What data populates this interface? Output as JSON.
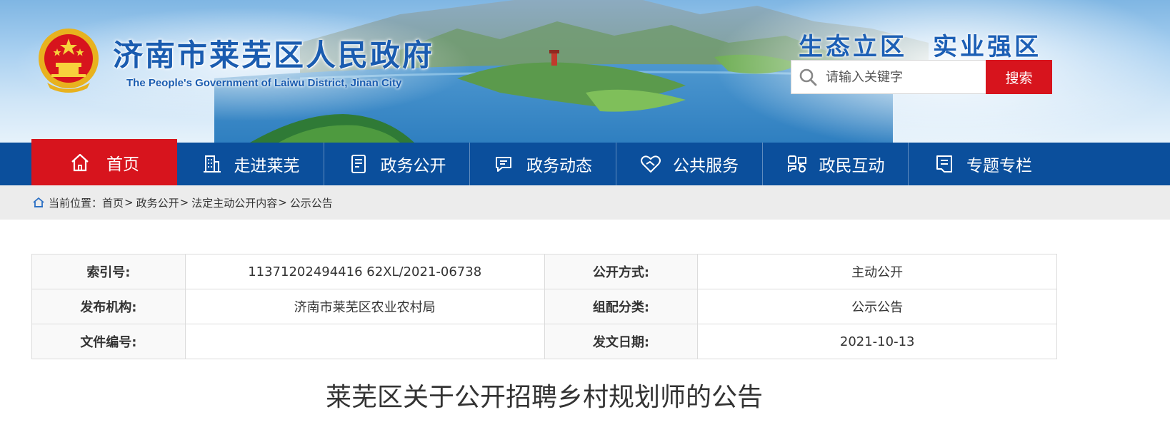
{
  "header": {
    "site_title": "济南市莱芜区人民政府",
    "site_subtitle": "The People's Government of Laiwu District, Jinan City",
    "slogan_left": "生态立区",
    "slogan_right": "实业强区",
    "emblem_icon": "national-emblem-icon"
  },
  "search": {
    "placeholder": "请输入关键字",
    "button_label": "搜索",
    "button_color": "#d7141d"
  },
  "nav": {
    "bar_color": "#0b4f9c",
    "active_color": "#d7141d",
    "items": [
      {
        "label": "首页",
        "icon": "home-icon",
        "active": true
      },
      {
        "label": "走进莱芜",
        "icon": "building-icon"
      },
      {
        "label": "政务公开",
        "icon": "document-icon"
      },
      {
        "label": "政务动态",
        "icon": "chat-icon"
      },
      {
        "label": "公共服务",
        "icon": "handshake-heart-icon"
      },
      {
        "label": "政民互动",
        "icon": "interaction-icon"
      },
      {
        "label": "专题专栏",
        "icon": "column-icon"
      }
    ]
  },
  "breadcrumb": {
    "prefix": "当前位置：",
    "items": [
      "首页",
      "政务公开",
      "法定主动公开内容",
      "公示公告"
    ],
    "separator": ">"
  },
  "meta": {
    "rows": [
      {
        "label1": "索引号:",
        "value1": "11371202494416 62XL/2021-06738",
        "label2": "公开方式:",
        "value2": "主动公开"
      },
      {
        "label1": "发布机构:",
        "value1": "济南市莱芜区农业农村局",
        "label2": "组配分类:",
        "value2": "公示公告"
      },
      {
        "label1": "文件编号:",
        "value1": "",
        "label2": "发文日期:",
        "value2": "2021-10-13"
      }
    ]
  },
  "article": {
    "title": "莱芜区关于公开招聘乡村规划师的公告"
  }
}
